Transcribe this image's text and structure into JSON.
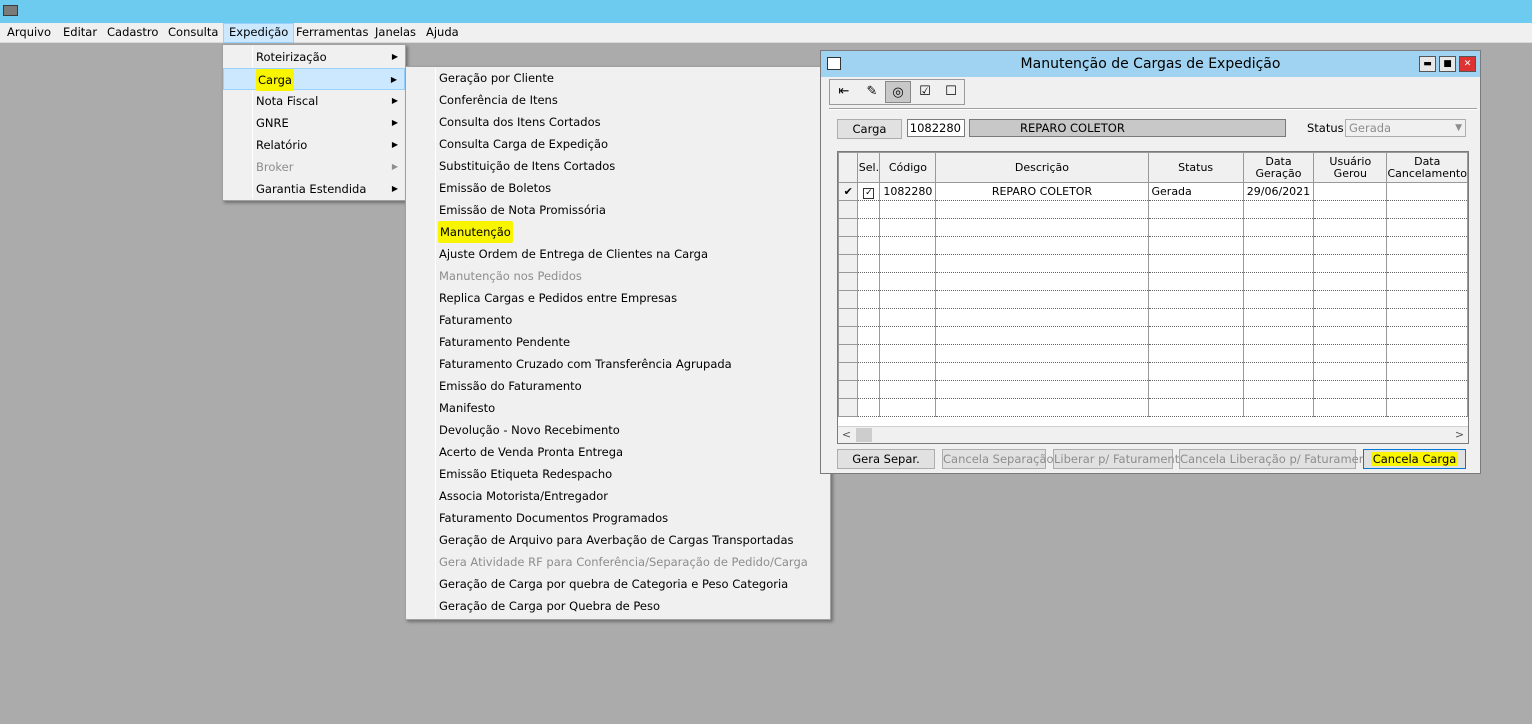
{
  "menubar": {
    "items": [
      "Arquivo",
      "Editar",
      "Cadastro",
      "Consulta",
      "Expedição",
      "Ferramentas",
      "Janelas",
      "Ajuda"
    ]
  },
  "expedicao_menu": {
    "items": [
      {
        "label": "Roteirização"
      },
      {
        "label": "Carga"
      },
      {
        "label": "Nota Fiscal"
      },
      {
        "label": "GNRE"
      },
      {
        "label": "Relatório"
      },
      {
        "label": "Broker"
      },
      {
        "label": "Garantia Estendida"
      }
    ]
  },
  "carga_submenu": {
    "items": [
      {
        "label": "Geração por Cliente"
      },
      {
        "label": "Conferência de Itens"
      },
      {
        "label": "Consulta dos Itens Cortados"
      },
      {
        "label": "Consulta Carga de Expedição"
      },
      {
        "label": "Substituição de Itens Cortados"
      },
      {
        "label": "Emissão de Boletos"
      },
      {
        "label": "Emissão de Nota Promissória"
      },
      {
        "label": "Manutenção"
      },
      {
        "label": "Ajuste Ordem de Entrega de Clientes na Carga"
      },
      {
        "label": "Manutenção nos Pedidos"
      },
      {
        "label": "Replica Cargas e Pedidos entre Empresas"
      },
      {
        "label": "Faturamento"
      },
      {
        "label": "Faturamento Pendente"
      },
      {
        "label": "Faturamento Cruzado com Transferência Agrupada"
      },
      {
        "label": "Emissão do Faturamento"
      },
      {
        "label": "Manifesto"
      },
      {
        "label": "Devolução - Novo Recebimento"
      },
      {
        "label": "Acerto de Venda Pronta Entrega"
      },
      {
        "label": "Emissão Etiqueta Redespacho"
      },
      {
        "label": "Associa Motorista/Entregador"
      },
      {
        "label": "Faturamento Documentos Programados"
      },
      {
        "label": "Geração de Arquivo para Averbação de Cargas Transportadas"
      },
      {
        "label": "Gera Atividade RF para Conferência/Separação de Pedido/Carga"
      },
      {
        "label": "Geração de Carga por quebra de Categoria e Peso Categoria"
      },
      {
        "label": "Geração de Carga por Quebra de Peso"
      }
    ]
  },
  "window": {
    "title": "Manutenção de Cargas de Expedição",
    "carga_button": "Carga",
    "carga_number": "1082280",
    "carga_description": "REPARO COLETOR",
    "status_label": "Status",
    "status_value": "Gerada",
    "grid": {
      "headers": [
        "Sel.",
        "Código",
        "Descrição",
        "Status",
        "Data Geração",
        "Usuário Gerou",
        "Data Cancelamento"
      ],
      "rows": [
        {
          "selected": true,
          "codigo": "1082280",
          "descricao": "REPARO COLETOR",
          "status": "Gerada",
          "data_geracao": "29/06/2021",
          "usuario": "",
          "data_cancelamento": ""
        }
      ]
    },
    "buttons": {
      "gera_separ": "Gera Separ.",
      "cancela_separacao": "Cancela Separação",
      "liberar_faturamento": "Liberar p/ Faturamento",
      "cancela_liberacao": "Cancela Liberação p/ Faturamento",
      "cancela_carga": "Cancela Carga"
    }
  },
  "colors": {
    "titlebar": "#6ecbf0",
    "highlight": "#f9f500",
    "desktop": "#ababab"
  }
}
